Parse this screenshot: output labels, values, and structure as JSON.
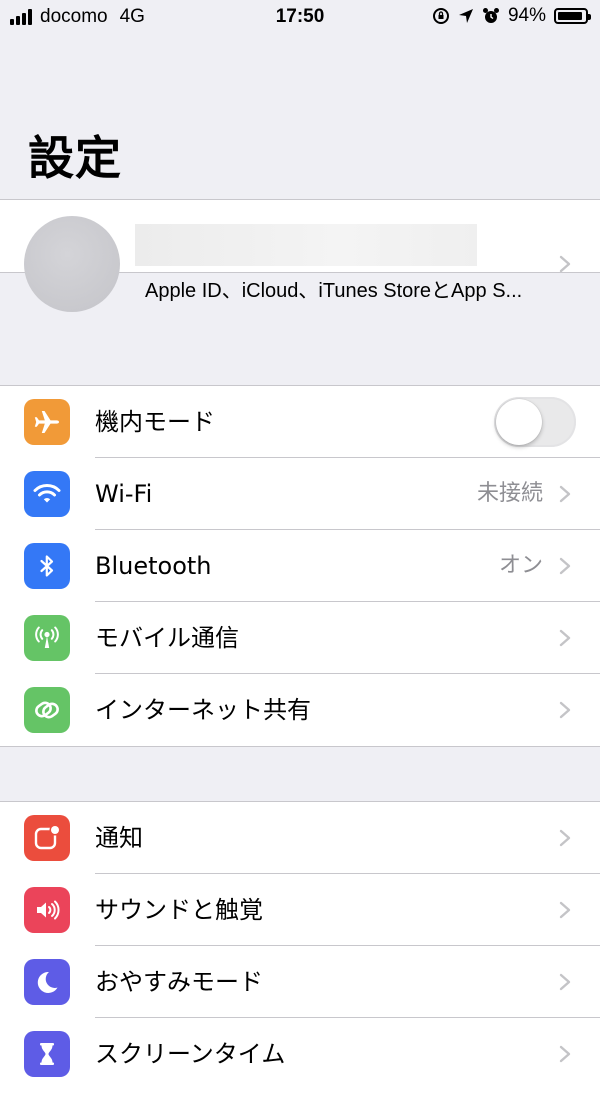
{
  "status_bar": {
    "carrier": "docomo",
    "network": "4G",
    "time": "17:50",
    "battery_text": "94%",
    "battery_level": 0.94
  },
  "page": {
    "title": "設定"
  },
  "profile": {
    "subtitle": "Apple ID、iCloud、iTunes StoreとApp S...",
    "avatar_icon": "avatar-placeholder"
  },
  "connectivity": {
    "airplane": {
      "label": "機内モード",
      "icon": "airplane-icon",
      "color": "#f19a38",
      "on": false
    },
    "wifi": {
      "label": "Wi-Fi",
      "value": "未接続",
      "icon": "wifi-icon",
      "color": "#3478f6"
    },
    "bluetooth": {
      "label": "Bluetooth",
      "value": "オン",
      "icon": "bluetooth-icon",
      "color": "#3478f6"
    },
    "cellular": {
      "label": "モバイル通信",
      "icon": "antenna-icon",
      "color": "#65c466"
    },
    "hotspot": {
      "label": "インターネット共有",
      "icon": "hotspot-chain-icon",
      "color": "#65c466"
    }
  },
  "system": {
    "notifications": {
      "label": "通知",
      "icon": "notification-badge-icon",
      "color": "#eb4d3d"
    },
    "sounds": {
      "label": "サウンドと触覚",
      "icon": "speaker-icon",
      "color": "#eb445a"
    },
    "dnd": {
      "label": "おやすみモード",
      "icon": "moon-icon",
      "color": "#5e5ce6"
    },
    "screentime": {
      "label": "スクリーンタイム",
      "icon": "hourglass-icon",
      "color": "#5e5ce6"
    }
  }
}
